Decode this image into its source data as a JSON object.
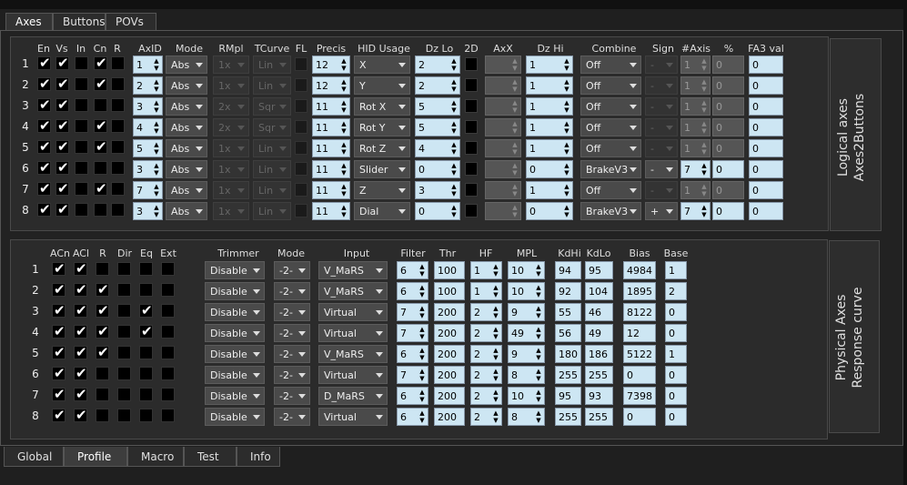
{
  "top_tabs": [
    "Axes",
    "Buttons",
    "POVs"
  ],
  "bottom_tabs": [
    "Global",
    "Profile",
    "Macro",
    "Test",
    "Info"
  ],
  "logical": {
    "side_label_1": "Logical axes",
    "side_label_2": "Axes2Buttons",
    "headers": {
      "en": "En",
      "vs": "Vs",
      "in": "In",
      "cn": "Cn",
      "r": "R",
      "axid": "AxID",
      "mode": "Mode",
      "rmpl": "RMpl",
      "tcurve": "TCurve",
      "fl": "FL",
      "precis": "Precis",
      "hid": "HID Usage",
      "dzlo": "Dz Lo",
      "twod": "2D",
      "axx": "AxX",
      "dzhi": "Dz Hi",
      "combine": "Combine",
      "sign": "Sign",
      "naxis": "#Axis",
      "pct": "%",
      "fa3": "FA3 val"
    },
    "rows": [
      {
        "n": "1",
        "en": true,
        "vs": true,
        "in": false,
        "cn": true,
        "r": false,
        "axid": "1",
        "mode": "Abs",
        "rmpl": "1x",
        "tcurve": "Lin",
        "precis": "12",
        "hid": "X",
        "dzlo": "2",
        "dzhi": "1",
        "combine": "Off",
        "sign": "-",
        "naxis": "1",
        "pct": "0",
        "pct_active": false,
        "fa3": "0"
      },
      {
        "n": "2",
        "en": true,
        "vs": true,
        "in": false,
        "cn": true,
        "r": false,
        "axid": "2",
        "mode": "Abs",
        "rmpl": "1x",
        "tcurve": "Lin",
        "precis": "12",
        "hid": "Y",
        "dzlo": "2",
        "dzhi": "1",
        "combine": "Off",
        "sign": "-",
        "naxis": "1",
        "pct": "0",
        "pct_active": false,
        "fa3": "0"
      },
      {
        "n": "3",
        "en": true,
        "vs": true,
        "in": false,
        "cn": false,
        "r": false,
        "axid": "3",
        "mode": "Abs",
        "rmpl": "2x",
        "tcurve": "Sqr",
        "precis": "11",
        "hid": "Rot X",
        "dzlo": "5",
        "dzhi": "1",
        "combine": "Off",
        "sign": "-",
        "naxis": "1",
        "pct": "0",
        "pct_active": false,
        "fa3": "0"
      },
      {
        "n": "4",
        "en": true,
        "vs": true,
        "in": false,
        "cn": true,
        "r": false,
        "axid": "4",
        "mode": "Abs",
        "rmpl": "2x",
        "tcurve": "Sqr",
        "precis": "11",
        "hid": "Rot Y",
        "dzlo": "5",
        "dzhi": "1",
        "combine": "Off",
        "sign": "-",
        "naxis": "1",
        "pct": "0",
        "pct_active": false,
        "fa3": "0"
      },
      {
        "n": "5",
        "en": true,
        "vs": true,
        "in": false,
        "cn": true,
        "r": false,
        "axid": "5",
        "mode": "Abs",
        "rmpl": "1x",
        "tcurve": "Lin",
        "precis": "11",
        "hid": "Rot Z",
        "dzlo": "4",
        "dzhi": "1",
        "combine": "Off",
        "sign": "-",
        "naxis": "1",
        "pct": "0",
        "pct_active": false,
        "fa3": "0"
      },
      {
        "n": "6",
        "en": true,
        "vs": true,
        "in": false,
        "cn": false,
        "r": false,
        "axid": "3",
        "mode": "Abs",
        "rmpl": "1x",
        "tcurve": "Lin",
        "precis": "11",
        "hid": "Slider",
        "dzlo": "0",
        "dzhi": "0",
        "combine": "BrakeV3",
        "sign": "-",
        "naxis": "7",
        "pct": "0",
        "pct_active": true,
        "fa3": "0"
      },
      {
        "n": "7",
        "en": true,
        "vs": true,
        "in": false,
        "cn": true,
        "r": false,
        "axid": "7",
        "mode": "Abs",
        "rmpl": "1x",
        "tcurve": "Lin",
        "precis": "11",
        "hid": "Z",
        "dzlo": "3",
        "dzhi": "1",
        "combine": "Off",
        "sign": "-",
        "naxis": "1",
        "pct": "0",
        "pct_active": false,
        "fa3": "0"
      },
      {
        "n": "8",
        "en": true,
        "vs": true,
        "in": false,
        "cn": false,
        "r": false,
        "axid": "3",
        "mode": "Abs",
        "rmpl": "1x",
        "tcurve": "Lin",
        "precis": "11",
        "hid": "Dial",
        "dzlo": "0",
        "dzhi": "0",
        "combine": "BrakeV3",
        "sign": "+",
        "naxis": "7",
        "pct": "0",
        "pct_active": true,
        "fa3": "0"
      }
    ]
  },
  "physical": {
    "side_label_1": "Physical Axes",
    "side_label_2": "Response curve",
    "headers": {
      "acn": "ACn",
      "acl": "ACl",
      "r": "R",
      "dir": "Dir",
      "eq": "Eq",
      "ext": "Ext",
      "trimmer": "Trimmer",
      "mode": "Mode",
      "input": "Input",
      "filter": "Filter",
      "thr": "Thr",
      "hf": "HF",
      "mpl": "MPL",
      "kdhi": "KdHi",
      "kdlo": "KdLo",
      "bias": "Bias",
      "base": "Base"
    },
    "rows": [
      {
        "n": "1",
        "acn": true,
        "acl": true,
        "r": false,
        "dir": false,
        "eq": false,
        "ext": false,
        "trimmer": "Disable",
        "mode": "-2-",
        "input": "V_MaRS",
        "filter": "6",
        "thr": "100",
        "hf": "1",
        "mpl": "10",
        "kdhi": "94",
        "kdlo": "95",
        "bias": "4984",
        "base": "1"
      },
      {
        "n": "2",
        "acn": true,
        "acl": true,
        "r": true,
        "dir": false,
        "eq": false,
        "ext": false,
        "trimmer": "Disable",
        "mode": "-2-",
        "input": "V_MaRS",
        "filter": "6",
        "thr": "100",
        "hf": "1",
        "mpl": "10",
        "kdhi": "92",
        "kdlo": "104",
        "bias": "1895",
        "base": "2"
      },
      {
        "n": "3",
        "acn": true,
        "acl": true,
        "r": true,
        "dir": false,
        "eq": true,
        "ext": false,
        "trimmer": "Disable",
        "mode": "-2-",
        "input": "Virtual",
        "filter": "7",
        "thr": "200",
        "hf": "2",
        "mpl": "9",
        "kdhi": "55",
        "kdlo": "46",
        "bias": "8122",
        "base": "0"
      },
      {
        "n": "4",
        "acn": true,
        "acl": true,
        "r": true,
        "dir": false,
        "eq": true,
        "ext": false,
        "trimmer": "Disable",
        "mode": "-2-",
        "input": "Virtual",
        "filter": "7",
        "thr": "200",
        "hf": "2",
        "mpl": "49",
        "kdhi": "56",
        "kdlo": "49",
        "bias": "12",
        "base": "0"
      },
      {
        "n": "5",
        "acn": true,
        "acl": true,
        "r": true,
        "dir": false,
        "eq": false,
        "ext": false,
        "trimmer": "Disable",
        "mode": "-2-",
        "input": "V_MaRS",
        "filter": "6",
        "thr": "200",
        "hf": "2",
        "mpl": "9",
        "kdhi": "180",
        "kdlo": "186",
        "bias": "5122",
        "base": "1"
      },
      {
        "n": "6",
        "acn": true,
        "acl": true,
        "r": false,
        "dir": false,
        "eq": false,
        "ext": false,
        "trimmer": "Disable",
        "mode": "-2-",
        "input": "Virtual",
        "filter": "7",
        "thr": "200",
        "hf": "2",
        "mpl": "8",
        "kdhi": "255",
        "kdlo": "255",
        "bias": "0",
        "base": "0"
      },
      {
        "n": "7",
        "acn": true,
        "acl": true,
        "r": false,
        "dir": false,
        "eq": false,
        "ext": false,
        "trimmer": "Disable",
        "mode": "-2-",
        "input": "D_MaRS",
        "filter": "6",
        "thr": "200",
        "hf": "2",
        "mpl": "10",
        "kdhi": "95",
        "kdlo": "93",
        "bias": "7398",
        "base": "0"
      },
      {
        "n": "8",
        "acn": true,
        "acl": true,
        "r": false,
        "dir": false,
        "eq": false,
        "ext": false,
        "trimmer": "Disable",
        "mode": "-2-",
        "input": "Virtual",
        "filter": "6",
        "thr": "200",
        "hf": "2",
        "mpl": "8",
        "kdhi": "255",
        "kdlo": "255",
        "bias": "0",
        "base": "0"
      }
    ]
  }
}
